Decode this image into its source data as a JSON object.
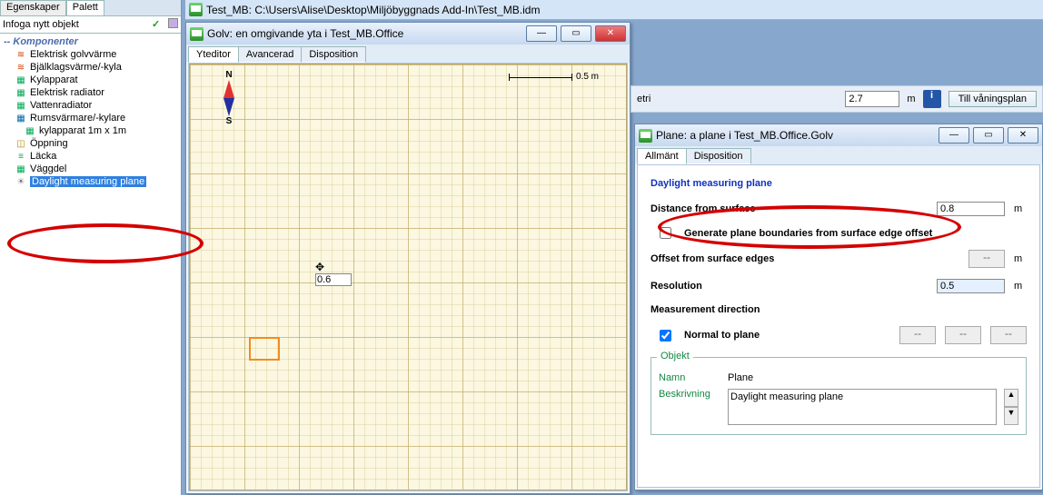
{
  "left_panel": {
    "tabs": {
      "prop": "Egenskaper",
      "pal": "Palett"
    },
    "insert_label": "Infoga nytt objekt",
    "cat_header": "Komponenter",
    "items": [
      "Elektrisk golvvärme",
      "Bjälklagsvärme/-kyla",
      "Kylapparat",
      "Elektrisk radiator",
      "Vattenradiator",
      "Rumsvärmare/-kylare",
      "kylapparat 1m x 1m",
      "Öppning",
      "Läcka",
      "Väggdel",
      "Daylight measuring plane"
    ]
  },
  "main_title": "Test_MB: C:\\Users\\Alise\\Desktop\\Miljöbyggnads Add-In\\Test_MB.idm",
  "doc_win": {
    "title": "Golv: en omgivande yta i Test_MB.Office",
    "tabs": {
      "a": "Yteditor",
      "b": "Avancerad",
      "c": "Disposition"
    },
    "compass_n": "N",
    "compass_s": "S",
    "scale_label": "0.5 m",
    "cursor_value": "0.6"
  },
  "fragment": {
    "mini_label": "etri",
    "value": "2.7",
    "btn": "Till våningsplan"
  },
  "plane_win": {
    "title": "Plane: a plane i Test_MB.Office.Golv",
    "tabs": {
      "a": "Allmänt",
      "b": "Disposition"
    },
    "header": "Daylight measuring plane",
    "distance_label": "Distance from surface",
    "distance_value": "0.8",
    "unit_m": "m",
    "gen_label": "Generate plane boundaries from surface edge offset",
    "offset_label": "Offset from surface edges",
    "offset_value": "--",
    "res_label": "Resolution",
    "res_value": "0.5",
    "md_label": "Measurement direction",
    "normal_label": "Normal to plane",
    "obj_legend": "Objekt",
    "name_k": "Namn",
    "name_v": "Plane",
    "desc_k": "Beskrivning",
    "desc_v": "Daylight measuring plane"
  }
}
